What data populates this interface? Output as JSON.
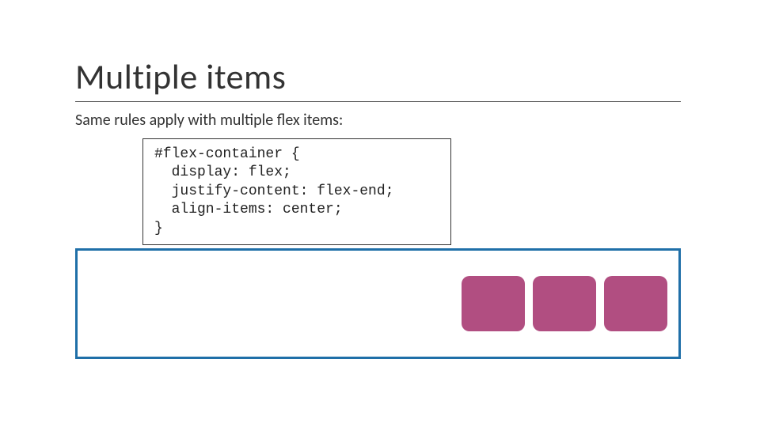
{
  "title": "Multiple items",
  "subtitle": "Same rules apply with multiple flex items:",
  "code": "#flex-container {\n  display: flex;\n  justify-content: flex-end;\n  align-items: center;\n}",
  "demo": {
    "border_color": "#1f6fa8",
    "item_color": "#b14e81",
    "item_count": 3
  }
}
